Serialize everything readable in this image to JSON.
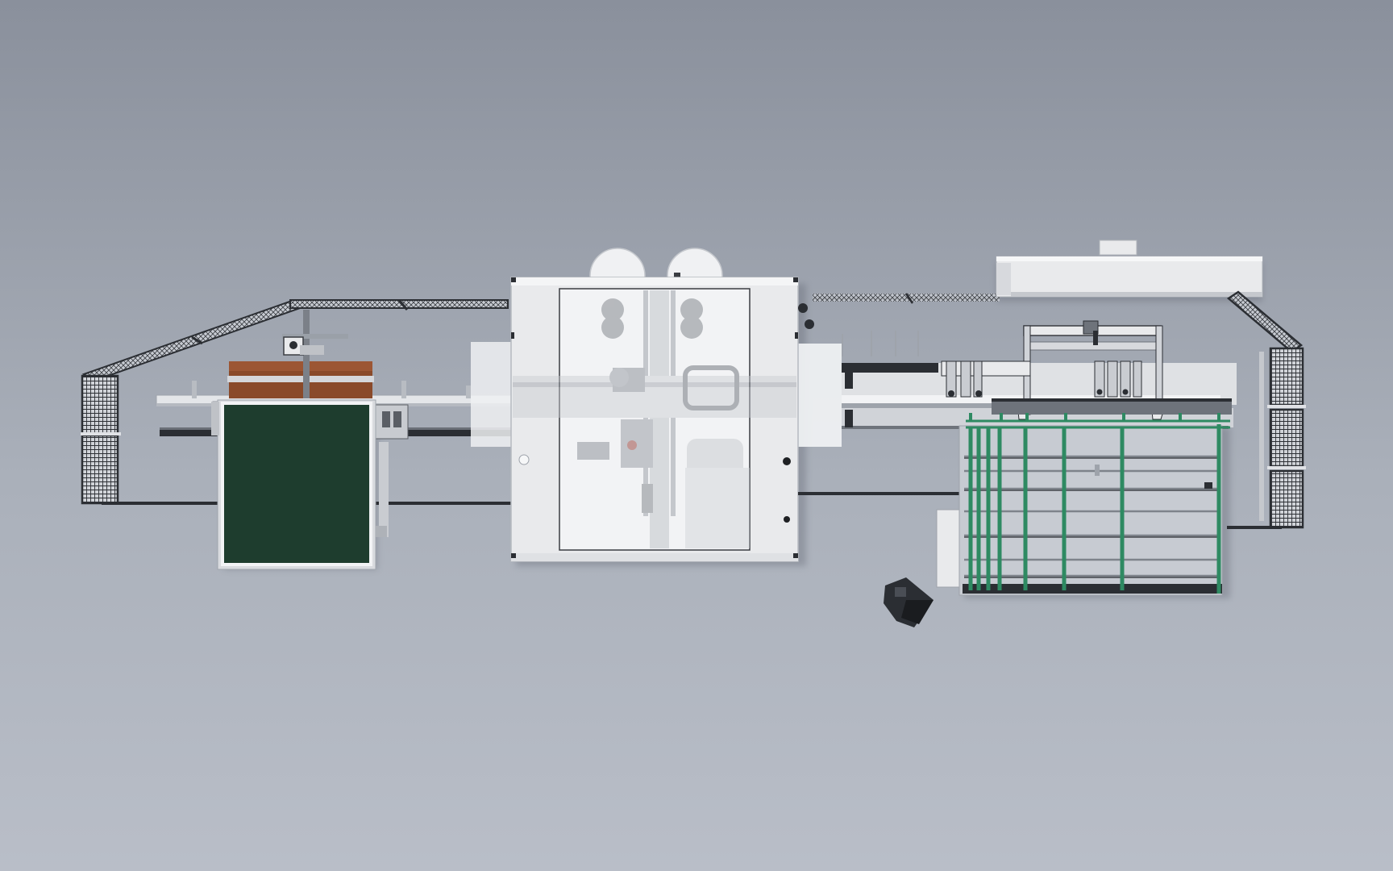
{
  "scene": {
    "colors": {
      "floor_top": "#8a909c",
      "floor_bottom": "#b9bec8",
      "machine_white": "#e9eaec",
      "machine_glass": "#f2f3f5",
      "fence_dark": "#2b2e33",
      "panel_green": "#1e3d2e",
      "rack_green": "#2e8a62",
      "wood_board": "#8a4a2a",
      "shadow": "#6f7580"
    },
    "components": [
      {
        "name": "left-safety-fence"
      },
      {
        "name": "board-infeed-stack"
      },
      {
        "name": "green-loading-table"
      },
      {
        "name": "central-processing-cabin"
      },
      {
        "name": "outfeed-conveyor"
      },
      {
        "name": "gantry-handler"
      },
      {
        "name": "overhead-housing"
      },
      {
        "name": "green-storage-rack"
      },
      {
        "name": "right-safety-fence"
      },
      {
        "name": "operator-console"
      }
    ]
  }
}
